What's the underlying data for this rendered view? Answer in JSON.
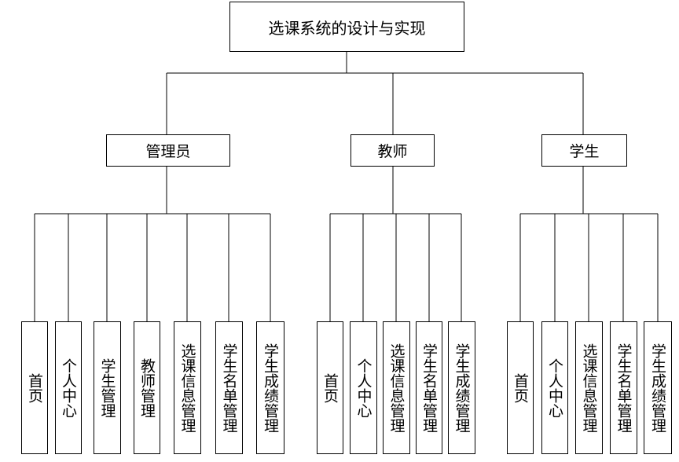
{
  "root": {
    "label": "选课系统的设计与实现"
  },
  "roles": [
    {
      "label": "管理员",
      "modules": [
        "首页",
        "个人中心",
        "学生管理",
        "教师管理",
        "选课信息管理",
        "学生名单管理",
        "学生成绩管理"
      ]
    },
    {
      "label": "教师",
      "modules": [
        "首页",
        "个人中心",
        "选课信息管理",
        "学生名单管理",
        "学生成绩管理"
      ]
    },
    {
      "label": "学生",
      "modules": [
        "首页",
        "个人中心",
        "选课信息管理",
        "学生名单管理",
        "学生成绩管理"
      ]
    }
  ]
}
